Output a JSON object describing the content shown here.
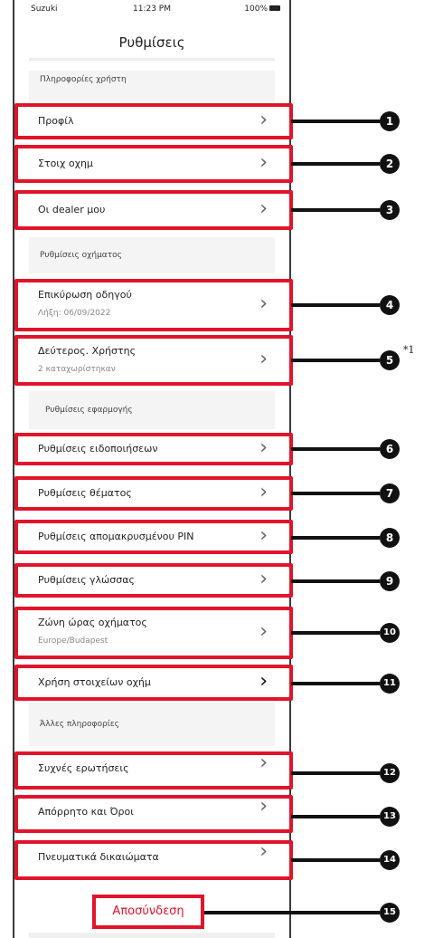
{
  "status": {
    "carrier": "Suzuki",
    "time": "11:23 PM",
    "battery": "100%"
  },
  "title": "Ρυθμίσεις",
  "sections": {
    "user_info": "Πληροφορίες χρήστη",
    "vehicle_settings": "Ρυθμίσεις οχήματος",
    "app_settings": "Ρυθμίσεις εφαρμογής",
    "other_info": "Άλλες πληροφορίες"
  },
  "items": {
    "profile": {
      "label": "Προφίλ",
      "badge": "1"
    },
    "vehicle_data": {
      "label": "Στοιχ οχημ",
      "badge": "2"
    },
    "my_dealers": {
      "label": "Οι dealer μου",
      "badge": "3"
    },
    "driver_verification": {
      "label": "Επικύρωση οδηγού",
      "sub": "Λήξη: 06/09/2022",
      "badge": "4"
    },
    "secondary_user": {
      "label": "Δεύτερος. Χρήστης",
      "sub": "2 καταχωρίστηκαν",
      "badge": "5"
    },
    "notifications": {
      "label": "Ρυθμίσεις ειδοποιήσεων",
      "badge": "6"
    },
    "theme": {
      "label": "Ρυθμίσεις θέματος",
      "badge": "7"
    },
    "remote_pin": {
      "label": "Ρυθμίσεις απομακρυσμένου PIN",
      "badge": "8"
    },
    "language": {
      "label": "Ρυθμίσεις γλώσσας",
      "badge": "9"
    },
    "timezone": {
      "label": "Ζώνη ώρας οχήματος",
      "sub": "Europe/Budapest",
      "badge": "10"
    },
    "vehicle_data_usage": {
      "label": "Χρήση στοιχείων οχήμ",
      "badge": "11"
    },
    "faq": {
      "label": "Συχνές ερωτήσεις",
      "badge": "12"
    },
    "privacy_terms": {
      "label": "Απόρρητο και Όροι",
      "badge": "13"
    },
    "copyright": {
      "label": "Πνευματικά δικαιώματα",
      "badge": "14"
    }
  },
  "logout": {
    "label": "Αποσύνδεση",
    "badge": "15"
  },
  "footnote": "*1",
  "colors": {
    "highlight": "#e1142b",
    "badge": "#111111"
  }
}
